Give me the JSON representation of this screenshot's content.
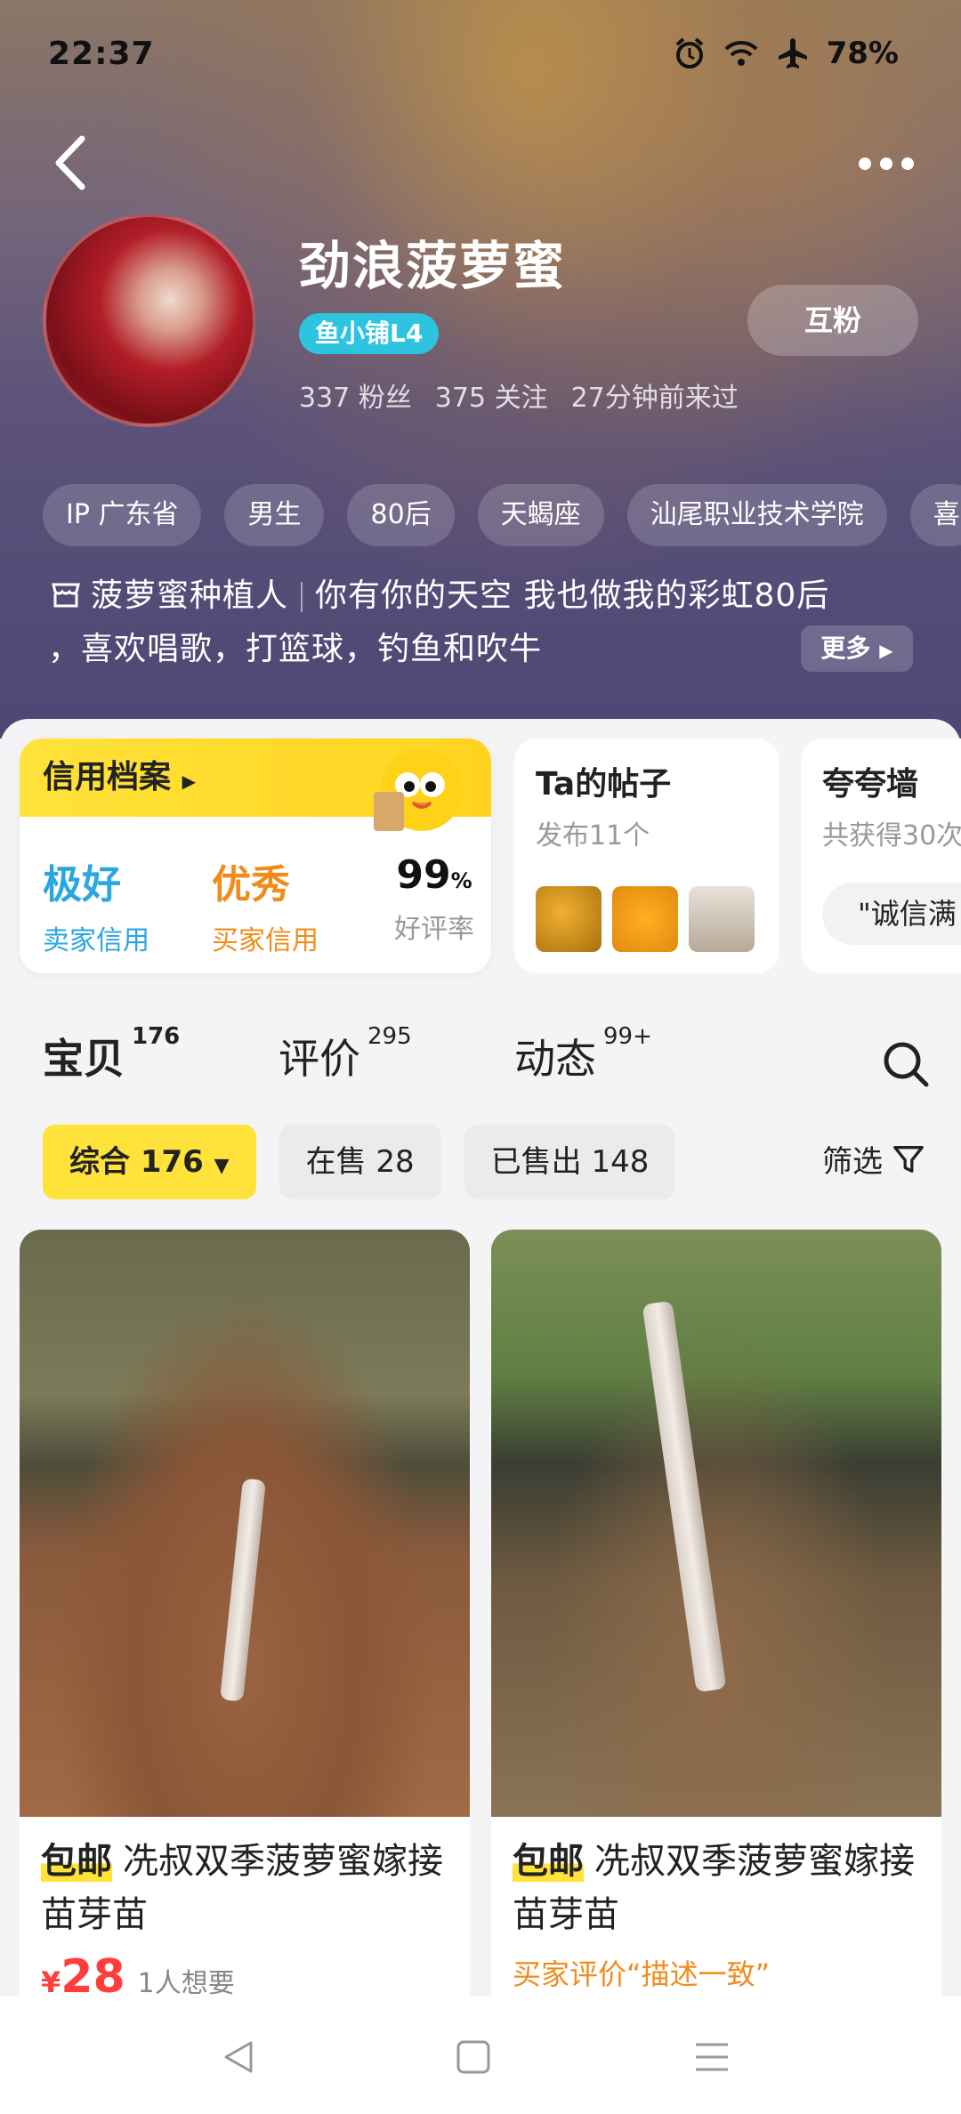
{
  "status_bar": {
    "time": "22:37",
    "battery": "78%"
  },
  "profile": {
    "name": "劲浪菠萝蜜",
    "badge": "鱼小铺L4",
    "mutual_button": "互粉",
    "followers": "337 粉丝",
    "following": "375 关注",
    "last_visit": "27分钟前来过",
    "tags": [
      "IP 广东省",
      "男生",
      "80后",
      "天蝎座",
      "汕尾职业技术学院",
      "喜"
    ],
    "bio_role": "菠萝蜜种植人",
    "bio_line1": "你有你的天空 我也做我的彩虹80后",
    "bio_line2": "，喜欢唱歌，打篮球，钓鱼和吹牛",
    "more_label": "更多"
  },
  "credit_card": {
    "title": "信用档案",
    "seller_value": "极好",
    "seller_label": "卖家信用",
    "buyer_value": "优秀",
    "buyer_label": "买家信用",
    "rating_value": "99",
    "rating_unit": "%",
    "rating_label": "好评率",
    "colors": {
      "seller": "#2aa6e0",
      "buyer": "#f08c1c"
    }
  },
  "posts_card": {
    "title": "Ta的帖子",
    "subtitle": "发布11个"
  },
  "praise_card": {
    "title": "夸夸墙",
    "subtitle": "共获得30次",
    "quote": "\"诚信满"
  },
  "tabs": [
    {
      "label": "宝贝",
      "count": "176"
    },
    {
      "label": "评价",
      "count": "295"
    },
    {
      "label": "动态",
      "count": "99+"
    }
  ],
  "filters": {
    "chips": [
      "综合 176",
      "在售 28",
      "已售出 148"
    ],
    "filter_label": "筛选"
  },
  "items": [
    {
      "tag": "包邮",
      "title": "冼叔双季菠萝蜜嫁接苗芽苗",
      "currency": "¥",
      "price": "28",
      "wants": "1人想要"
    },
    {
      "tag": "包邮",
      "title": "冼叔双季菠萝蜜嫁接苗芽苗",
      "review": "买家评价“描述一致”"
    }
  ]
}
